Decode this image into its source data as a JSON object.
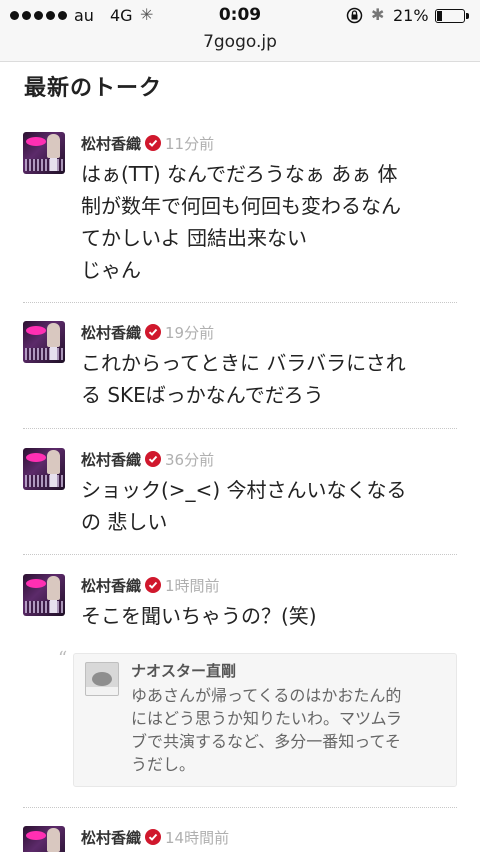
{
  "status_bar": {
    "carrier": "au",
    "network": "4G",
    "activity_icon": "loading-spinner-icon",
    "time": "0:09",
    "rotation_lock_icon": "rotation-lock-icon",
    "bluetooth_icon": "bluetooth-icon",
    "battery_percent_text": "21%",
    "battery_level": 0.21
  },
  "browser": {
    "url": "7gogo.jp"
  },
  "section": {
    "title": "最新のトーク"
  },
  "posts": [
    {
      "author": "松村香織",
      "time": "11分前",
      "lines": [
        "はぁ(TT) なんでだろうなぁ あぁ 体",
        "制が数年で何回も何回も変わるなん",
        "てかしいよ 団結出来ない",
        "じゃん"
      ]
    },
    {
      "author": "松村香織",
      "time": "19分前",
      "lines": [
        "これからってときに バラバラにされ",
        "る SKEばっかなんでだろう"
      ]
    },
    {
      "author": "松村香織",
      "time": "36分前",
      "lines": [
        "ショック(>_<) 今村さんいなくなる",
        "の 悲しい"
      ]
    },
    {
      "author": "松村香織",
      "time": "1時間前",
      "lines": [
        "そこを聞いちゃうの？(笑)"
      ],
      "quote": {
        "mark": "“",
        "author": "ナオスター直剛",
        "lines": [
          "ゆあさんが帰ってくるのはかおたん的",
          "にはどう思うか知りたいわ。マツムラ",
          "ブで共演するなど、多分一番知ってそ",
          "うだし。"
        ]
      }
    },
    {
      "author": "松村香織",
      "time": "14時間前",
      "lines": []
    }
  ],
  "colors": {
    "verified_badge": "#d0182d",
    "time_text": "#b0b0b0",
    "background": "#ffffff"
  }
}
